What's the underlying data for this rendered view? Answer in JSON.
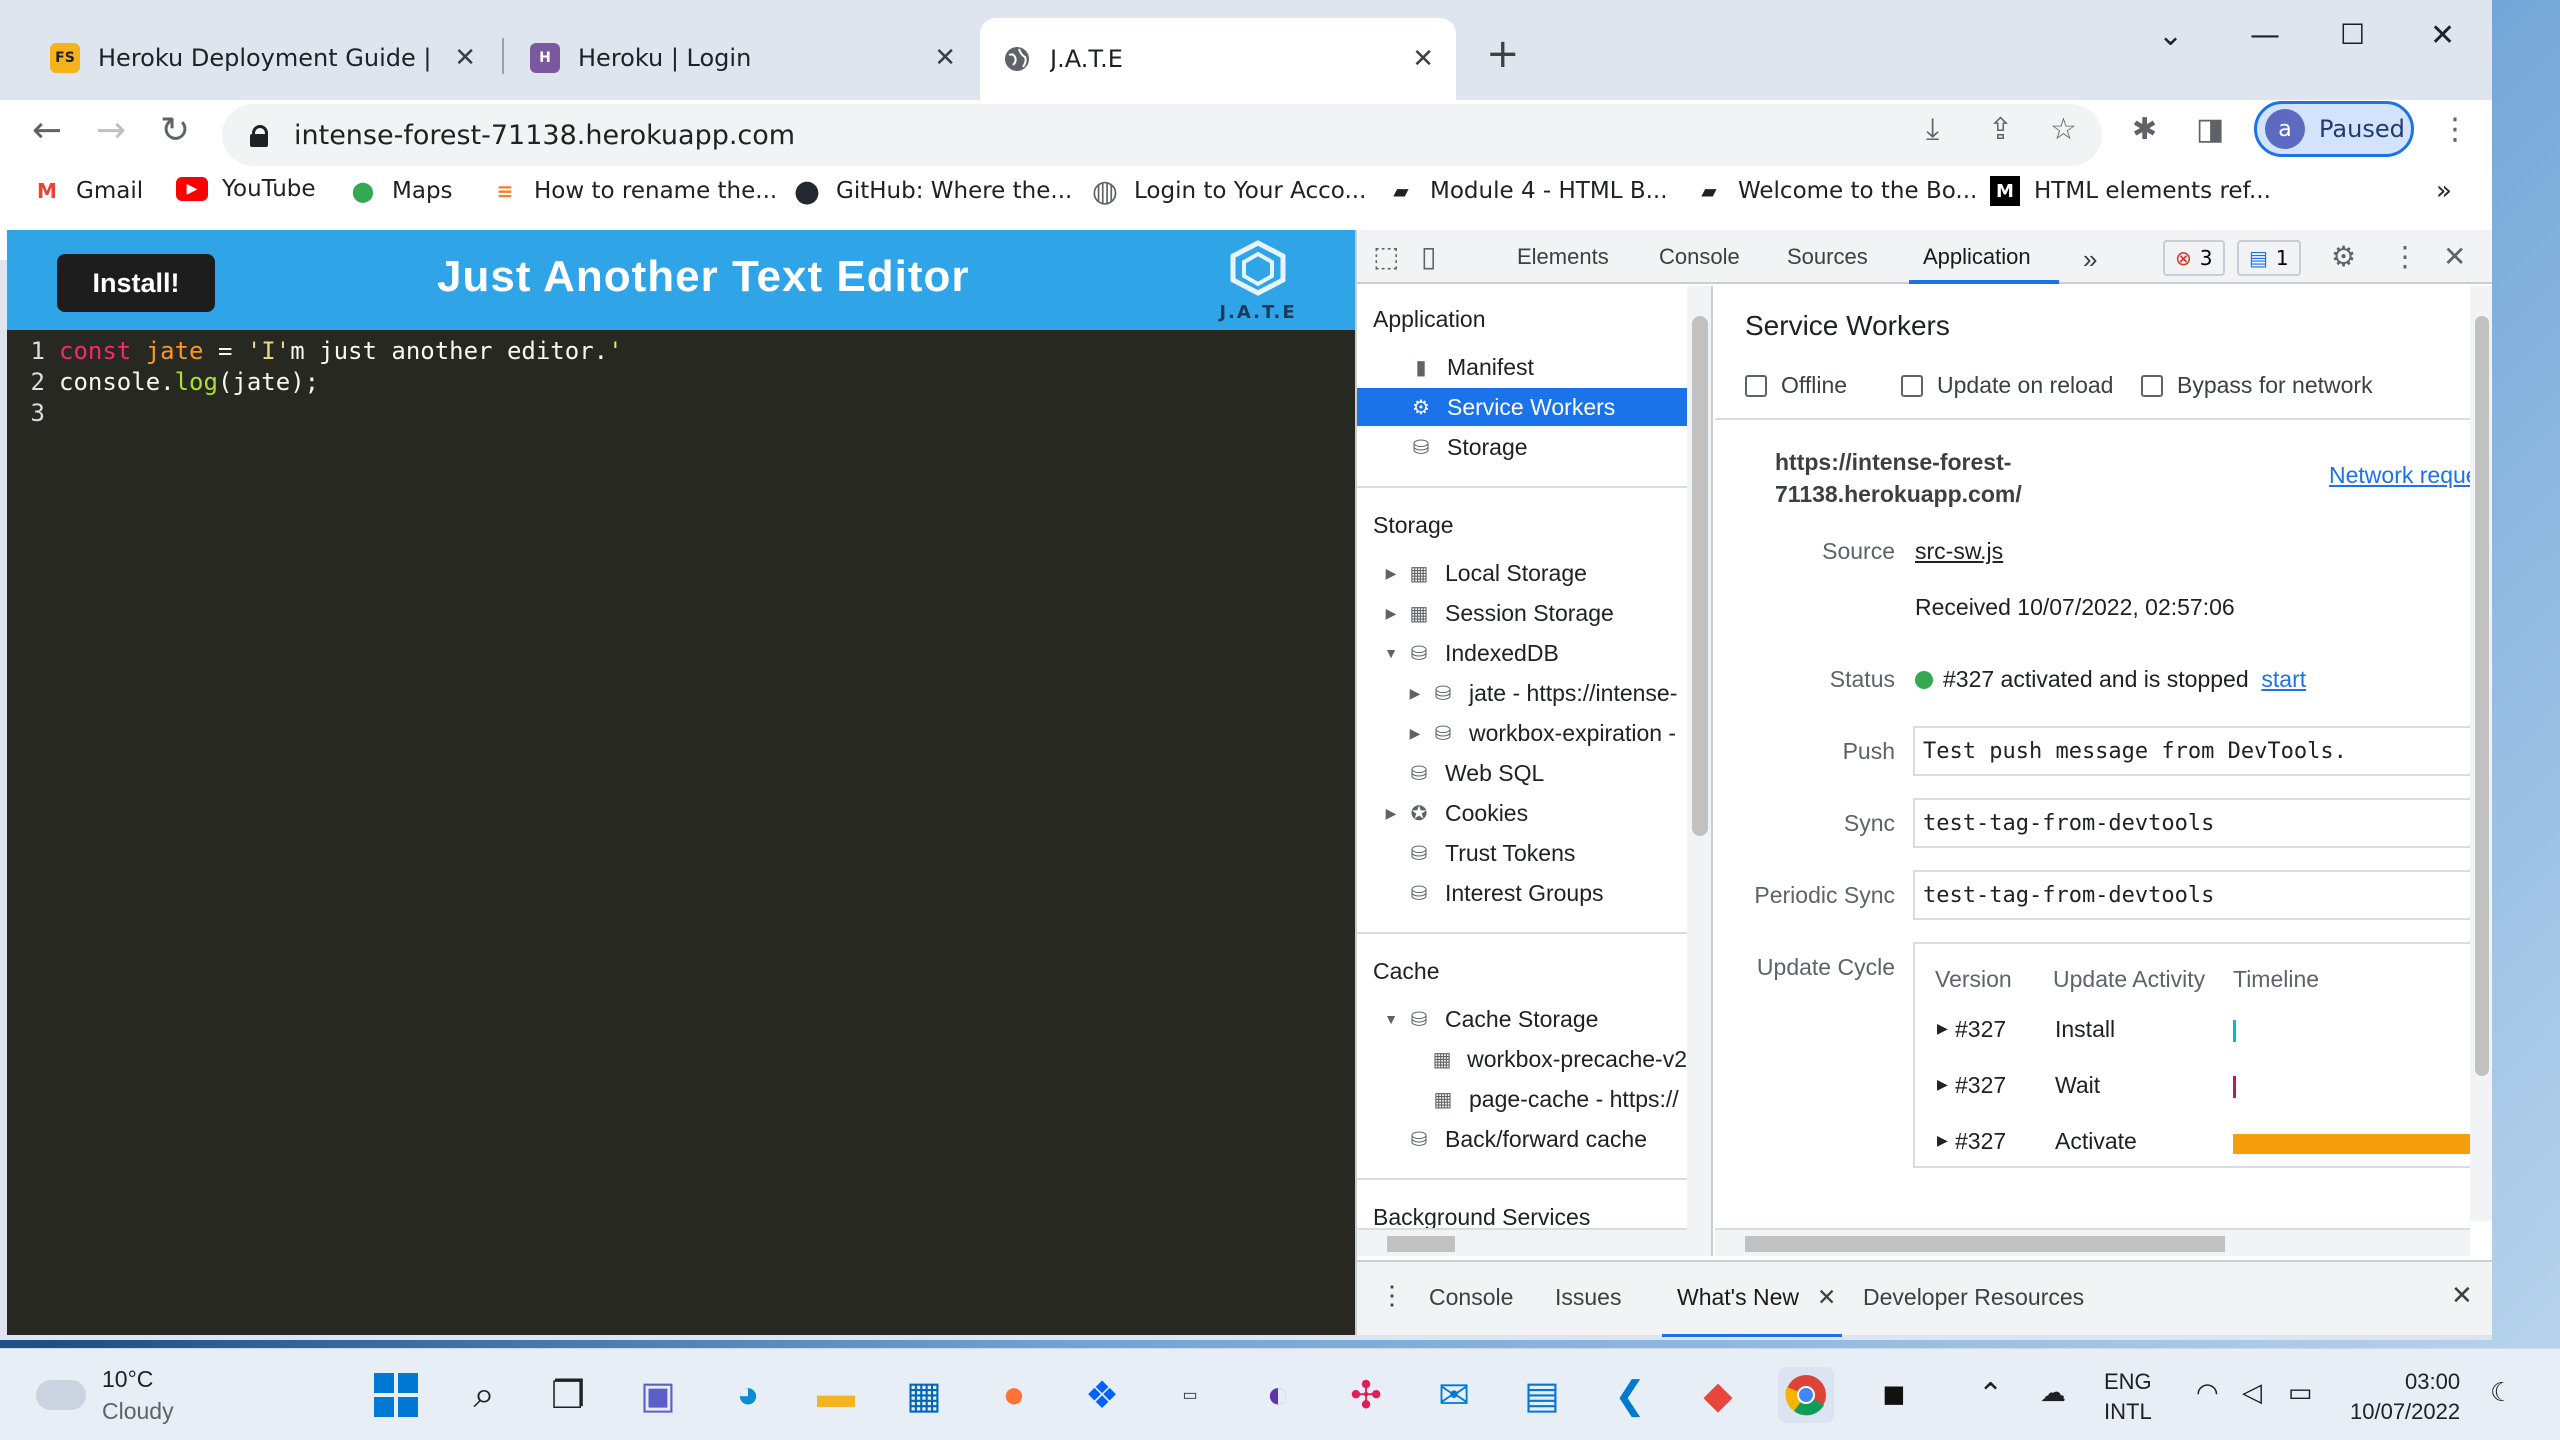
{
  "browser": {
    "tabs": [
      {
        "title": "Heroku Deployment Guide | The",
        "favicon": "FS",
        "color": "#f6b21a"
      },
      {
        "title": "Heroku | Login",
        "favicon": "H",
        "color": "#79589f"
      },
      {
        "title": "J.A.T.E",
        "favicon": "globe-icon",
        "color": "#5f6368"
      }
    ],
    "url": "intense-forest-71138.herokuapp.com",
    "profile": {
      "initial": "a",
      "status": "Paused"
    },
    "bookmarks": [
      {
        "label": "Gmail",
        "icon": "M",
        "color": "#ea4335"
      },
      {
        "label": "YouTube",
        "icon": "▶",
        "color": "#ff0000"
      },
      {
        "label": "Maps",
        "icon": "📍",
        "color": "#34a853"
      },
      {
        "label": "How to rename the...",
        "icon": "≡",
        "color": "#f48024"
      },
      {
        "label": "GitHub: Where the...",
        "icon": "●",
        "color": "#24292f"
      },
      {
        "label": "Login to Your Acco...",
        "icon": "◍",
        "color": "#5f6368"
      },
      {
        "label": "Module 4 - HTML B...",
        "icon": "▰",
        "color": "#202124"
      },
      {
        "label": "Welcome to the Bo...",
        "icon": "▰",
        "color": "#202124"
      },
      {
        "label": "HTML elements ref...",
        "icon": "M",
        "color": "#000000"
      }
    ],
    "bookmarks_more": "»"
  },
  "app": {
    "install_label": "Install!",
    "title": "Just Another Text Editor",
    "logo_text": "J.A.T.E",
    "code_lines": [
      {
        "n": "1",
        "tokens": [
          [
            "kw",
            "const"
          ],
          [
            "plain",
            " "
          ],
          [
            "vr",
            "jate"
          ],
          [
            "plain",
            " = "
          ],
          [
            "str",
            "'I'"
          ],
          [
            "plain",
            "m just another editor."
          ],
          [
            "str",
            "'"
          ]
        ]
      },
      {
        "n": "2",
        "tokens": [
          [
            "plain",
            "console."
          ],
          [
            "fn",
            "log"
          ],
          [
            "plain",
            "(jate);"
          ]
        ]
      },
      {
        "n": "3",
        "tokens": []
      }
    ]
  },
  "devtools": {
    "tabs": [
      "Elements",
      "Console",
      "Sources",
      "Application"
    ],
    "active_tab": "Application",
    "more": "»",
    "error_count": "3",
    "message_count": "1",
    "sidebar": {
      "application_title": "Application",
      "application_items": [
        "Manifest",
        "Service Workers",
        "Storage"
      ],
      "storage_title": "Storage",
      "storage_items": [
        "Local Storage",
        "Session Storage",
        "IndexedDB",
        "jate - https://intense-",
        "workbox-expiration -",
        "Web SQL",
        "Cookies",
        "Trust Tokens",
        "Interest Groups"
      ],
      "cache_title": "Cache",
      "cache_items": [
        "Cache Storage",
        "workbox-precache-v2",
        "page-cache - https://",
        "Back/forward cache"
      ],
      "bg_title": "Background Services"
    },
    "service_workers": {
      "title": "Service Workers",
      "checkboxes": [
        "Offline",
        "Update on reload",
        "Bypass for network"
      ],
      "origin_line1": "https://intense-forest-",
      "origin_line2": "71138.herokuapp.com/",
      "network_link": "Network requests",
      "source_label": "Source",
      "source_value": "src-sw.js",
      "received": "Received 10/07/2022, 02:57:06",
      "status_label": "Status",
      "status_value": "#327 activated and is stopped",
      "status_link": "start",
      "push_label": "Push",
      "push_value": "Test push message from DevTools.",
      "sync_label": "Sync",
      "sync_value": "test-tag-from-devtools",
      "periodic_label": "Periodic Sync",
      "periodic_value": "test-tag-from-devtools",
      "update_cycle_label": "Update Cycle",
      "table_headers": [
        "Version",
        "Update Activity",
        "Timeline"
      ],
      "rows": [
        {
          "version": "#327",
          "activity": "Install"
        },
        {
          "version": "#327",
          "activity": "Wait"
        },
        {
          "version": "#327",
          "activity": "Activate"
        }
      ]
    },
    "drawer_tabs": [
      "Console",
      "Issues",
      "What's New",
      "Developer Resources"
    ],
    "drawer_active": "What's New"
  },
  "taskbar": {
    "weather_temp": "10°C",
    "weather_desc": "Cloudy",
    "lang_top": "ENG",
    "lang_bottom": "INTL",
    "time": "03:00",
    "date": "10/07/2022"
  }
}
